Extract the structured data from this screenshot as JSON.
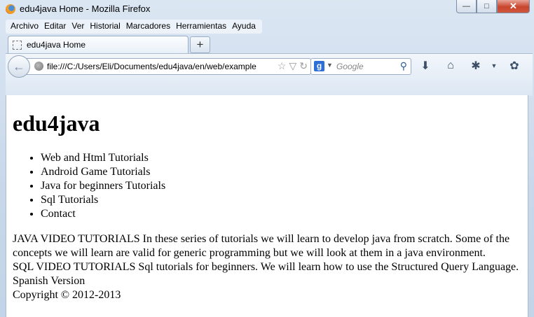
{
  "window": {
    "title": "edu4java Home - Mozilla Firefox",
    "controls": {
      "minimize": "—",
      "maximize": "□",
      "close": "✕"
    }
  },
  "menubar": {
    "items": [
      "Archivo",
      "Editar",
      "Ver",
      "Historial",
      "Marcadores",
      "Herramientas",
      "Ayuda"
    ]
  },
  "tabs": [
    {
      "label": "edu4java Home"
    }
  ],
  "newtab": {
    "label": "+"
  },
  "navbar": {
    "back_icon": "←",
    "url": "file:///C:/Users/Eli/Documents/edu4java/en/web/example",
    "star_icon": "☆",
    "dropdown_icon": "▽",
    "reload_icon": "↻",
    "search": {
      "engine": "g",
      "caret": "▼",
      "placeholder": "Google",
      "go_icon": "⚲"
    },
    "download_icon": "⬇",
    "home_icon": "⌂",
    "addon_icon": "✱",
    "menu_caret_icon": "▼",
    "extra_icon": "✿"
  },
  "page": {
    "heading": "edu4java",
    "links": [
      "Web and Html Tutorials",
      "Android Game Tutorials",
      "Java for beginners Tutorials",
      "Sql Tutorials",
      "Contact"
    ],
    "java_text": "JAVA VIDEO TUTORIALS In these series of tutorials we will learn to develop java from scratch. Some of the concepts we will learn are valid for generic programming but we will look at them in a java environment.",
    "sql_text": "SQL VIDEO TUTORIALS Sql tutorials for beginners. We will learn how to use the Structured Query Language.",
    "spanish": "Spanish Version",
    "copyright": "Copyright © 2012-2013"
  }
}
